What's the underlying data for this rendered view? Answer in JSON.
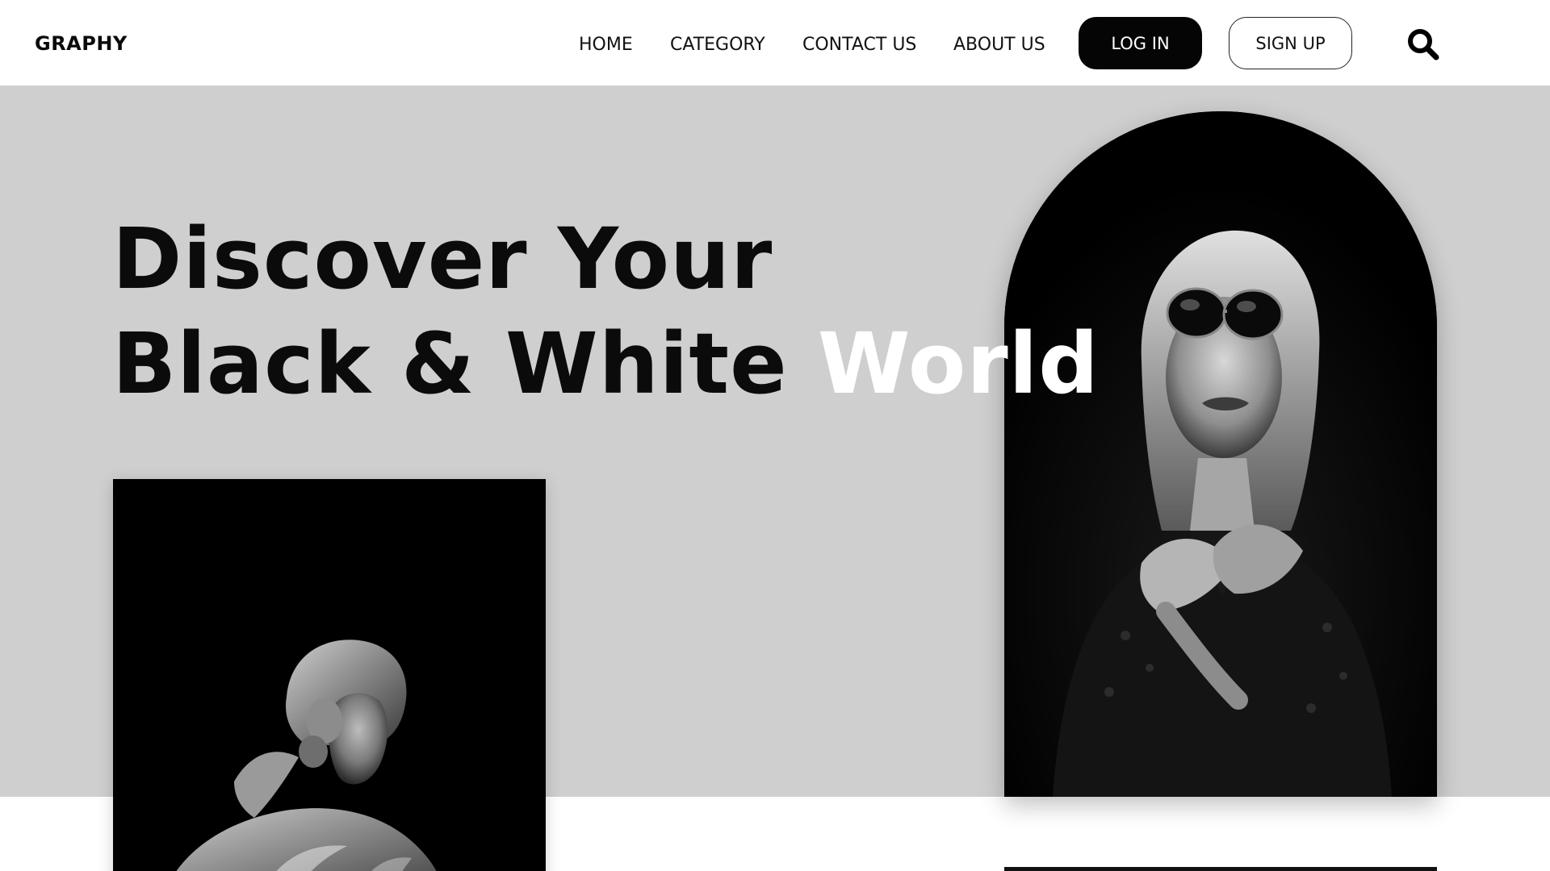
{
  "brand": "GRAPHY",
  "nav": {
    "home": "HOME",
    "category": "CATEGORY",
    "contact": "CONTACT US",
    "about": "ABOUT US"
  },
  "auth": {
    "login": "LOG IN",
    "signup": "SIGN UP"
  },
  "hero": {
    "line1": "Discover Your",
    "line2": "Black & White",
    "line2_accent": "World"
  },
  "icons": {
    "search": "search-icon"
  },
  "colors": {
    "hero_bg": "#cfcfcf",
    "accent_text": "#ffffff",
    "button_dark": "#050505"
  }
}
